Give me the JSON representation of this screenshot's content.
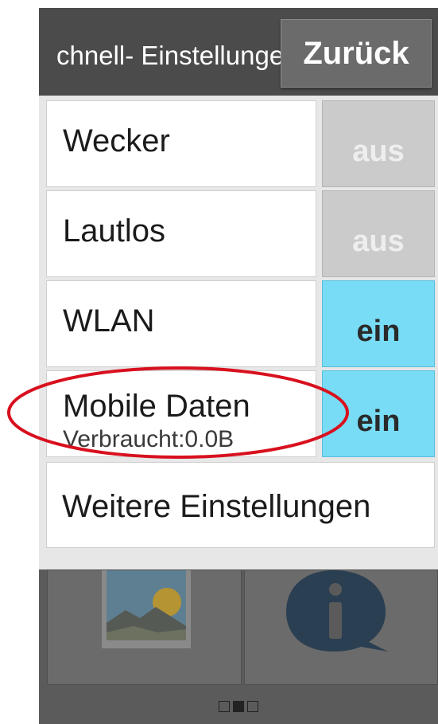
{
  "dialog": {
    "title": "chnell- Einstellungen",
    "back_label": "Zurück"
  },
  "settings": [
    {
      "label": "Wecker",
      "subtitle": "",
      "state": "aus"
    },
    {
      "label": "Lautlos",
      "subtitle": "",
      "state": "aus"
    },
    {
      "label": "WLAN",
      "subtitle": "",
      "state": "ein"
    },
    {
      "label": "Mobile Daten",
      "subtitle": "Verbraucht:0.0B",
      "state": "ein"
    }
  ],
  "more_settings_label": "Weitere Einstellungen",
  "home": {
    "apps": [
      {
        "icon": "gallery-icon"
      },
      {
        "icon": "info-icon"
      }
    ],
    "pager": {
      "pages": 3,
      "current": 2
    }
  },
  "colors": {
    "toggle_on": "#78dcf6",
    "toggle_off": "#cbcbcb",
    "annotation": "#d8101e"
  }
}
